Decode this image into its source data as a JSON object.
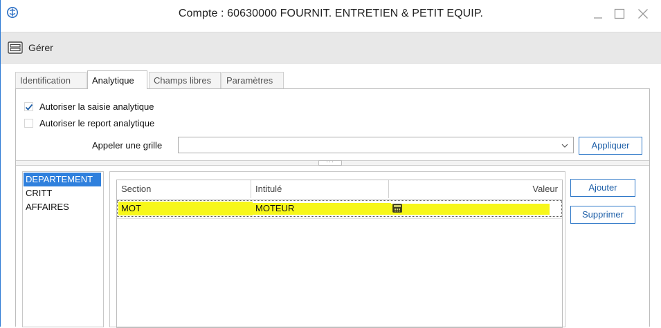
{
  "window": {
    "title": "Compte : 60630000 FOURNIT. ENTRETIEN & PETIT EQUIP.",
    "controls": {
      "minimize": "_",
      "maximize": "□",
      "close": "✕"
    }
  },
  "ribbon": {
    "manage_label": "Gérer"
  },
  "tabs": [
    {
      "label": "Identification",
      "active": false
    },
    {
      "label": "Analytique",
      "active": true
    },
    {
      "label": "Champs libres",
      "active": false
    },
    {
      "label": "Paramètres",
      "active": false
    }
  ],
  "analytique": {
    "allow_entry": {
      "label": "Autoriser la saisie analytique",
      "checked": true
    },
    "allow_carry": {
      "label": "Autoriser le report analytique",
      "checked": false
    },
    "grid_label": "Appeler une grille",
    "grid_value": "",
    "apply_label": "Appliquer",
    "splitter_grip": "···",
    "axes": [
      {
        "label": "DEPARTEMENT",
        "selected": true
      },
      {
        "label": "CRITT",
        "selected": false
      },
      {
        "label": "AFFAIRES",
        "selected": false
      }
    ],
    "table": {
      "columns": {
        "section": "Section",
        "intitule": "Intitulé",
        "valeur": "Valeur"
      },
      "rows": [
        {
          "section": "MOT",
          "intitule": "MOTEUR",
          "valeur_icon": "calculator-icon"
        }
      ]
    },
    "add_label": "Ajouter",
    "delete_label": "Supprimer"
  },
  "colors": {
    "accent": "#2f80dd",
    "button_border": "#2e78c8",
    "highlight": "#f7f71a",
    "ribbon_bg": "#e8e8e8"
  }
}
